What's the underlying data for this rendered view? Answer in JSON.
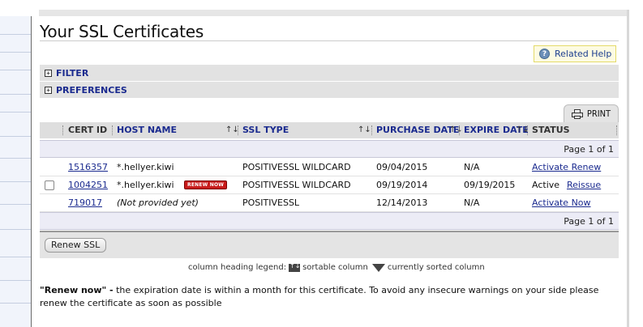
{
  "page": {
    "title": "Your SSL Certificates"
  },
  "related_help": {
    "label": "Related Help",
    "icon": "help-question-icon"
  },
  "sections": {
    "filter": "FILTER",
    "preferences": "PREFERENCES",
    "expander_glyph": "+"
  },
  "print": {
    "label": "PRINT",
    "icon": "printer-icon"
  },
  "table": {
    "columns": {
      "cert_id": "CERT ID",
      "host_name": "HOST NAME",
      "ssl_type": "SSL TYPE",
      "purchase_date": "PURCHASE DATE",
      "expire_date": "EXPIRE DATE",
      "status": "STATUS"
    },
    "sort_glyph": "↑↓",
    "pager_top": "Page 1 of 1",
    "pager_bottom": "Page 1 of 1",
    "rows": [
      {
        "has_checkbox": false,
        "cert_id": "1516357",
        "host_name": "*.hellyer.kiwi",
        "badge": "",
        "ssl_type": "POSITIVESSL WILDCARD",
        "purchase_date": "09/04/2015",
        "expire_date": "N/A",
        "status_text": "",
        "status_action": "Activate Renew"
      },
      {
        "has_checkbox": true,
        "cert_id": "1004251",
        "host_name": "*.hellyer.kiwi",
        "badge": "RENEW NOW",
        "ssl_type": "POSITIVESSL WILDCARD",
        "purchase_date": "09/19/2014",
        "expire_date": "09/19/2015",
        "status_text": "Active",
        "status_action": "Reissue"
      },
      {
        "has_checkbox": false,
        "cert_id": "719017",
        "host_name": "(Not provided yet)",
        "badge": "",
        "ssl_type": "POSITIVESSL",
        "purchase_date": "12/14/2013",
        "expire_date": "N/A",
        "status_text": "",
        "status_action": "Activate Now"
      }
    ]
  },
  "actions": {
    "renew_ssl": "Renew SSL"
  },
  "legend": {
    "prefix": "column heading legend:",
    "sortable": "sortable column",
    "sorted": "currently sorted column"
  },
  "note": {
    "bold": "\"Renew now\" -",
    "text": " the expiration date is within a month for this certificate. To avoid any insecure warnings on your side please renew the certificate as soon as possible"
  },
  "colors": {
    "link": "#1b2b8f",
    "badge": "#c81b1b",
    "help_border": "#e3da69",
    "section_bg": "#e2e2e2"
  }
}
